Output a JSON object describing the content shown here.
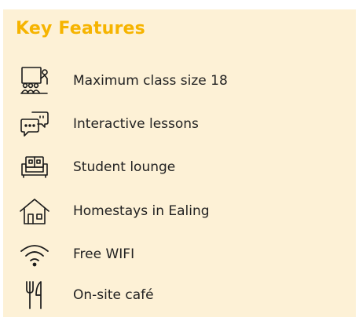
{
  "section": {
    "title": "Key Features"
  },
  "features": [
    {
      "icon": "classroom-icon",
      "label": "Maximum class size 18"
    },
    {
      "icon": "chat-bubbles-icon",
      "label": "Interactive lessons"
    },
    {
      "icon": "sofa-icon",
      "label": "Student lounge"
    },
    {
      "icon": "house-icon",
      "label": "Homestays in Ealing"
    },
    {
      "icon": "wifi-icon",
      "label": "Free WIFI"
    },
    {
      "icon": "fork-knife-icon",
      "label": "On-site café"
    }
  ],
  "colors": {
    "panel_background": "#fdf1d6",
    "title": "#f6b400",
    "text": "#222222",
    "icon": "#1a1a1a"
  }
}
